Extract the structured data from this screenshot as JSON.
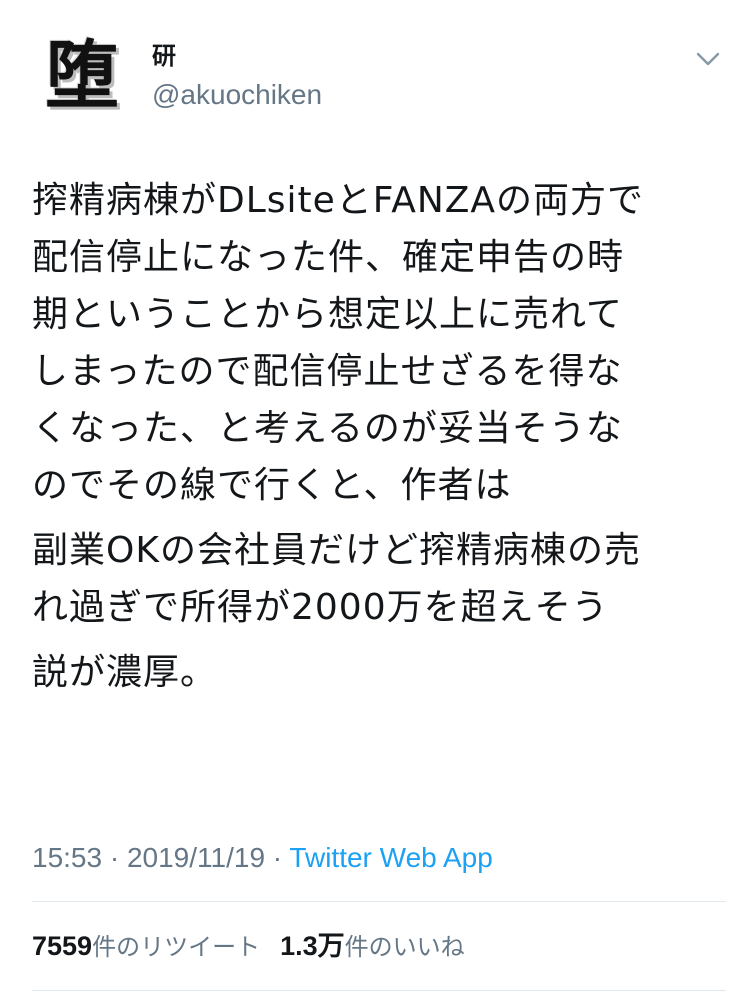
{
  "author": {
    "avatar_glyph": "堕",
    "display_name": "研",
    "handle": "@akuochiken"
  },
  "header": {
    "menu_icon": "chevron-down-icon"
  },
  "tweet": {
    "paragraphs": [
      "搾精病棟がDLsiteとFANZAの両方で\n配信停止になった件、確定申告の時\n期ということから想定以上に売れて\nしまったので配信停止せざるを得な\nくなった、と考えるのが妥当そうな\nのでその線で行くと、作者は",
      "副業OKの会社員だけど搾精病棟の売\nれ過ぎで所得が2000万を超えそう",
      "説が濃厚。"
    ]
  },
  "meta": {
    "time": "15:53",
    "separator": " · ",
    "date": "2019/11/19",
    "app": "Twitter Web App"
  },
  "stats": {
    "retweets_count": "7559",
    "retweets_label": "件のリツイート",
    "likes_count": "1.3万",
    "likes_label": "件のいいね"
  },
  "colors": {
    "text": "#14171a",
    "secondary": "#657786",
    "link": "#1da1f2",
    "divider": "#e1e8ed"
  }
}
